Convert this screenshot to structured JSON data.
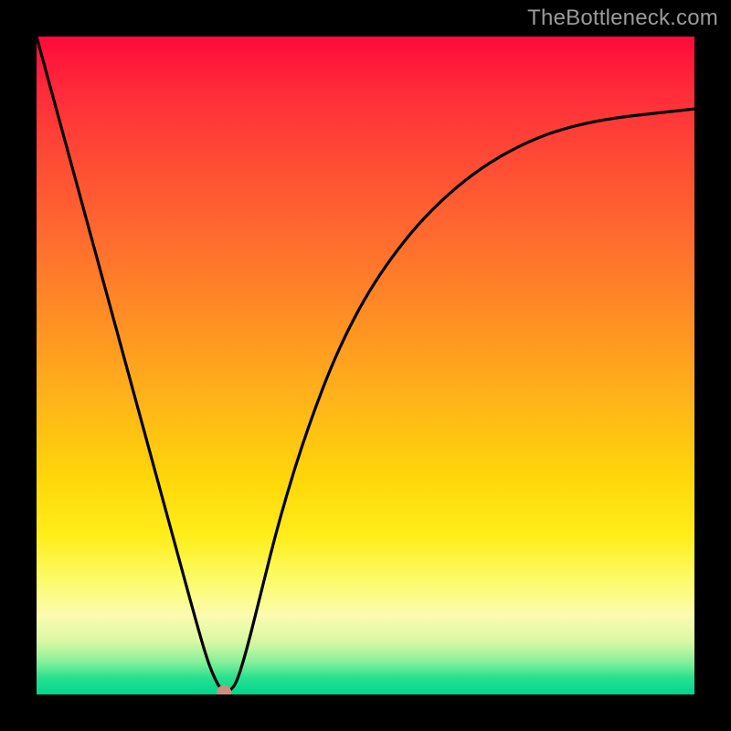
{
  "watermark": "TheBottleneck.com",
  "chart_data": {
    "type": "line",
    "title": "",
    "xlabel": "",
    "ylabel": "",
    "xlim": [
      0,
      100
    ],
    "ylim": [
      0,
      100
    ],
    "grid": false,
    "legend": false,
    "background_gradient": {
      "direction": "vertical",
      "stops": [
        {
          "pos": 0,
          "color": "#ff0a3a"
        },
        {
          "pos": 30,
          "color": "#ff6a2f"
        },
        {
          "pos": 60,
          "color": "#ffd60a"
        },
        {
          "pos": 85,
          "color": "#fcfbb0"
        },
        {
          "pos": 100,
          "color": "#00d68f"
        }
      ]
    },
    "series": [
      {
        "name": "bottleneck-curve",
        "x": [
          0,
          3,
          6,
          9,
          12,
          15,
          18,
          21,
          24,
          26,
          27.5,
          28.5,
          29.5,
          30.5,
          32,
          34,
          37,
          41,
          46,
          52,
          60,
          70,
          82,
          100
        ],
        "y": [
          100,
          89,
          78,
          67,
          56,
          45,
          34,
          23,
          12,
          5,
          1.5,
          0.3,
          0.6,
          2,
          7,
          15,
          27,
          40,
          53,
          64,
          74,
          82,
          87,
          89
        ]
      }
    ],
    "markers": [
      {
        "name": "optimal-point",
        "x": 28.5,
        "y": 0.3,
        "color": "#cf8d7e"
      }
    ]
  }
}
